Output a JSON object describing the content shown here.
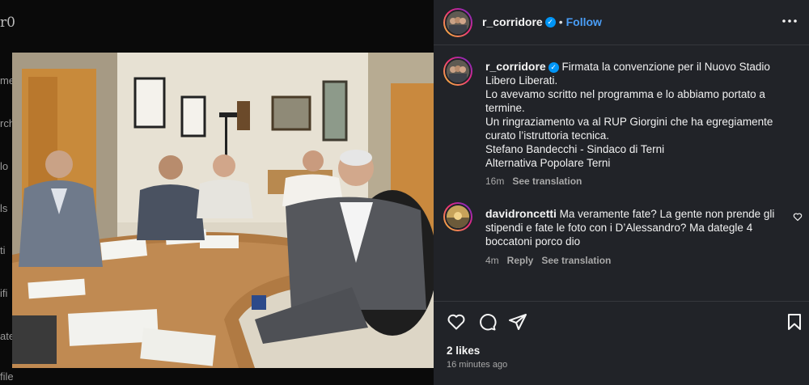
{
  "background": {
    "logo_fragment": "r0",
    "side_fragments": [
      "me",
      "rch",
      "lo",
      "ls",
      "ti",
      "ifi",
      "ate",
      "file"
    ]
  },
  "post": {
    "author": {
      "username": "r_corridore",
      "verified": true
    },
    "header": {
      "separator": "•",
      "follow_label": "Follow"
    },
    "caption": {
      "text": "Firmata la convenzione per il Nuovo Stadio Libero Liberati.\nLo avevamo scritto nel programma e lo abbiamo portato a termine.\nUn ringraziamento va al RUP Giorgini che ha egregiamente curato l’istruttoria tecnica.\nStefano Bandecchi - Sindaco di Terni\nAlternativa Popolare Terni",
      "age": "16m",
      "see_translation": "See translation"
    },
    "comments": [
      {
        "username": "davidroncetti",
        "text": "Ma veramente fate? La gente non prende gli stipendi e fate le foto con i D’Alessandro? Ma dategle 4 boccatoni porco dio",
        "age": "4m",
        "reply_label": "Reply",
        "see_translation": "See translation"
      }
    ],
    "likes_label": "2 likes",
    "timestamp": "16 minutes ago"
  },
  "icons": {
    "verified": "verified-badge-icon",
    "more": "more-options-icon",
    "like": "heart-icon",
    "comment": "comment-icon",
    "share": "share-icon",
    "save": "bookmark-icon",
    "comment_like": "heart-small-icon"
  },
  "colors": {
    "panel_bg": "#212328",
    "accent": "#4a9ef7",
    "verified": "#0095f6",
    "muted": "#a8a8a8"
  }
}
